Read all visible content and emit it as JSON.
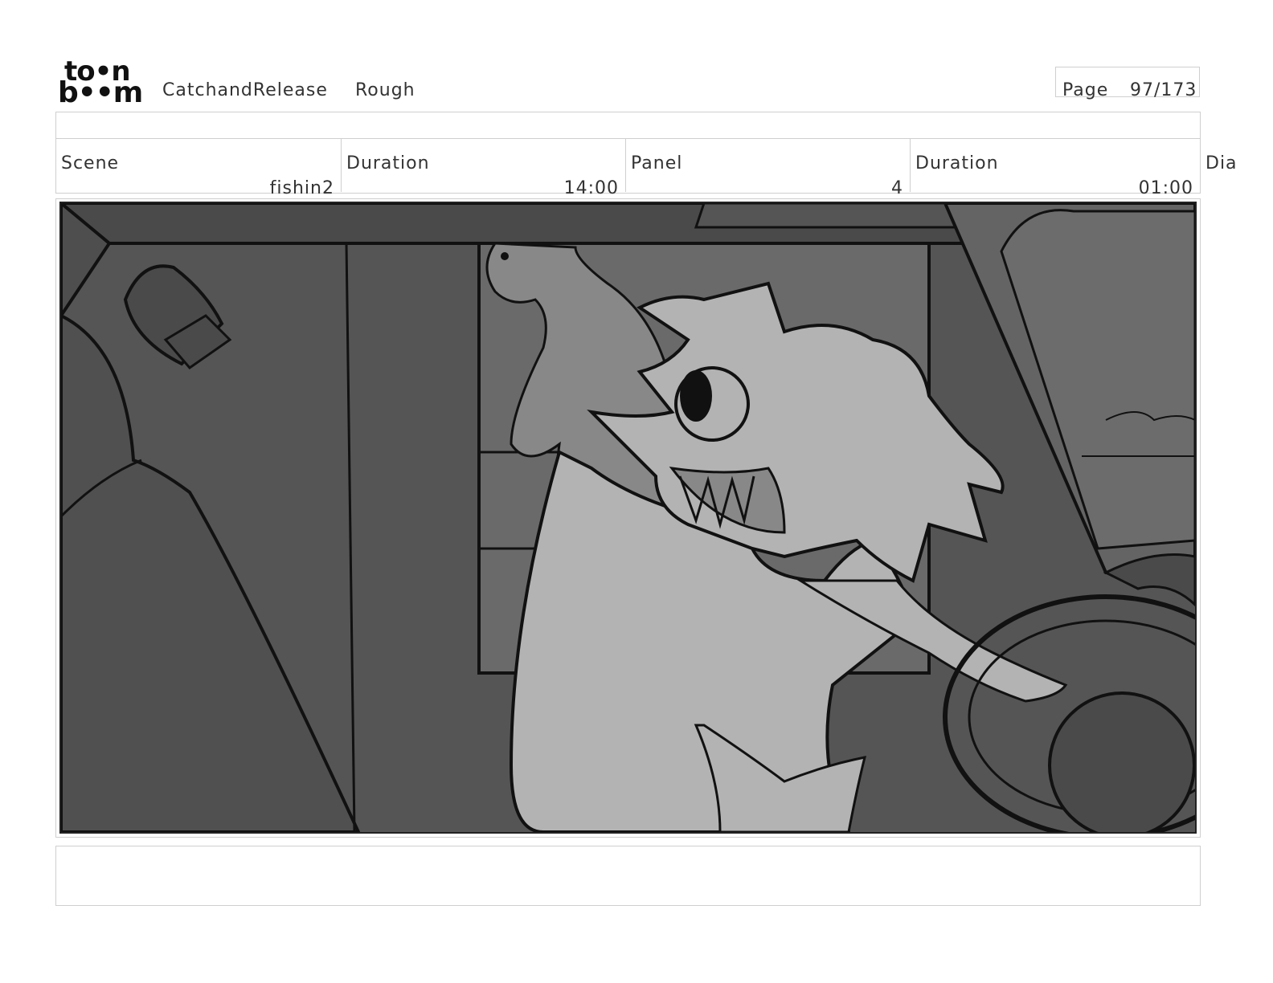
{
  "logo": {
    "line1": "to•n",
    "line2": "b••m"
  },
  "header": {
    "project_title": "CatchandRelease",
    "stage": "Rough",
    "page_label": "Page",
    "page_number": "97/173"
  },
  "info": {
    "scene_label": "Scene",
    "scene_value": "fishin2",
    "scene_duration_label": "Duration",
    "scene_duration_value": "14:00",
    "panel_label": "Panel",
    "panel_value": "4",
    "panel_duration_label": "Duration",
    "panel_duration_value": "01:00",
    "dialogue_label": "Dia"
  },
  "colors": {
    "frame_border": "#cfcfcf",
    "sketch_dark": "#4a4a4a",
    "sketch_mid": "#6e6e6e",
    "sketch_light": "#b3b3b3",
    "ink": "#111111"
  }
}
